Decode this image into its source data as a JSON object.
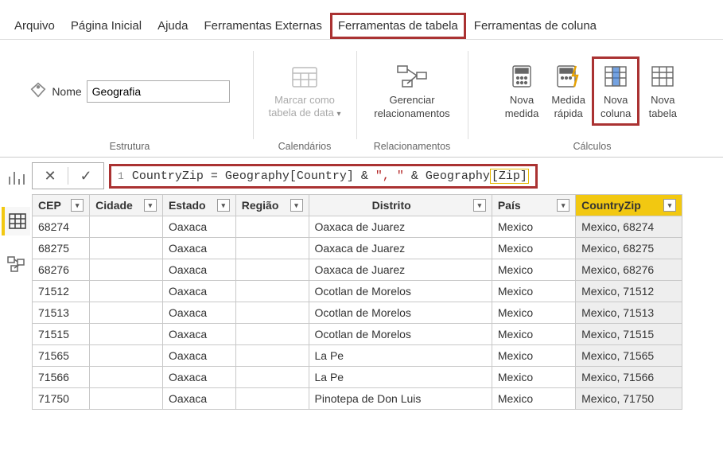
{
  "menu": {
    "items": [
      {
        "label": "Arquivo"
      },
      {
        "label": "Página Inicial"
      },
      {
        "label": "Ajuda"
      },
      {
        "label": "Ferramentas Externas"
      },
      {
        "label": "Ferramentas de tabela",
        "active": true,
        "highlighted": true
      },
      {
        "label": "Ferramentas de coluna"
      }
    ]
  },
  "ribbon": {
    "structure": {
      "name_label": "Nome",
      "name_value": "Geografia",
      "group_label": "Estrutura"
    },
    "calendars": {
      "mark_as_date_line1": "Marcar como",
      "mark_as_date_line2": "tabela de data",
      "group_label": "Calendários"
    },
    "relationships": {
      "manage_line1": "Gerenciar",
      "manage_line2": "relacionamentos",
      "group_label": "Relacionamentos"
    },
    "calcs": {
      "new_measure_line1": "Nova",
      "new_measure_line2": "medida",
      "quick_measure_line1": "Medida",
      "quick_measure_line2": "rápida",
      "new_column_line1": "Nova",
      "new_column_line2": "coluna",
      "new_table_line1": "Nova",
      "new_table_line2": "tabela",
      "group_label": "Cálculos"
    }
  },
  "formula": {
    "line_no": "1",
    "expr": {
      "p1": "CountryZip = Geography[Country] & ",
      "str": "\", \"",
      "p2": " & Geography",
      "ref": "[Zip]"
    }
  },
  "table": {
    "headers": [
      "CEP",
      "Cidade",
      "Estado",
      "Região",
      "Distrito",
      "País",
      "CountryZip"
    ],
    "rows": [
      {
        "cep": "68274",
        "cidade": "",
        "estado": "Oaxaca",
        "regiao": "",
        "distrito": "Oaxaca de Juarez",
        "pais": "Mexico",
        "czip": "Mexico, 68274"
      },
      {
        "cep": "68275",
        "cidade": "",
        "estado": "Oaxaca",
        "regiao": "",
        "distrito": "Oaxaca de Juarez",
        "pais": "Mexico",
        "czip": "Mexico, 68275"
      },
      {
        "cep": "68276",
        "cidade": "",
        "estado": "Oaxaca",
        "regiao": "",
        "distrito": "Oaxaca de Juarez",
        "pais": "Mexico",
        "czip": "Mexico, 68276"
      },
      {
        "cep": "71512",
        "cidade": "",
        "estado": "Oaxaca",
        "regiao": "",
        "distrito": "Ocotlan de Morelos",
        "pais": "Mexico",
        "czip": "Mexico, 71512"
      },
      {
        "cep": "71513",
        "cidade": "",
        "estado": "Oaxaca",
        "regiao": "",
        "distrito": "Ocotlan de Morelos",
        "pais": "Mexico",
        "czip": "Mexico, 71513"
      },
      {
        "cep": "71515",
        "cidade": "",
        "estado": "Oaxaca",
        "regiao": "",
        "distrito": "Ocotlan de Morelos",
        "pais": "Mexico",
        "czip": "Mexico, 71515"
      },
      {
        "cep": "71565",
        "cidade": "",
        "estado": "Oaxaca",
        "regiao": "",
        "distrito": "La Pe",
        "pais": "Mexico",
        "czip": "Mexico, 71565"
      },
      {
        "cep": "71566",
        "cidade": "",
        "estado": "Oaxaca",
        "regiao": "",
        "distrito": "La Pe",
        "pais": "Mexico",
        "czip": "Mexico, 71566"
      },
      {
        "cep": "71750",
        "cidade": "",
        "estado": "Oaxaca",
        "regiao": "",
        "distrito": "Pinotepa de Don Luis",
        "pais": "Mexico",
        "czip": "Mexico, 71750"
      }
    ]
  }
}
